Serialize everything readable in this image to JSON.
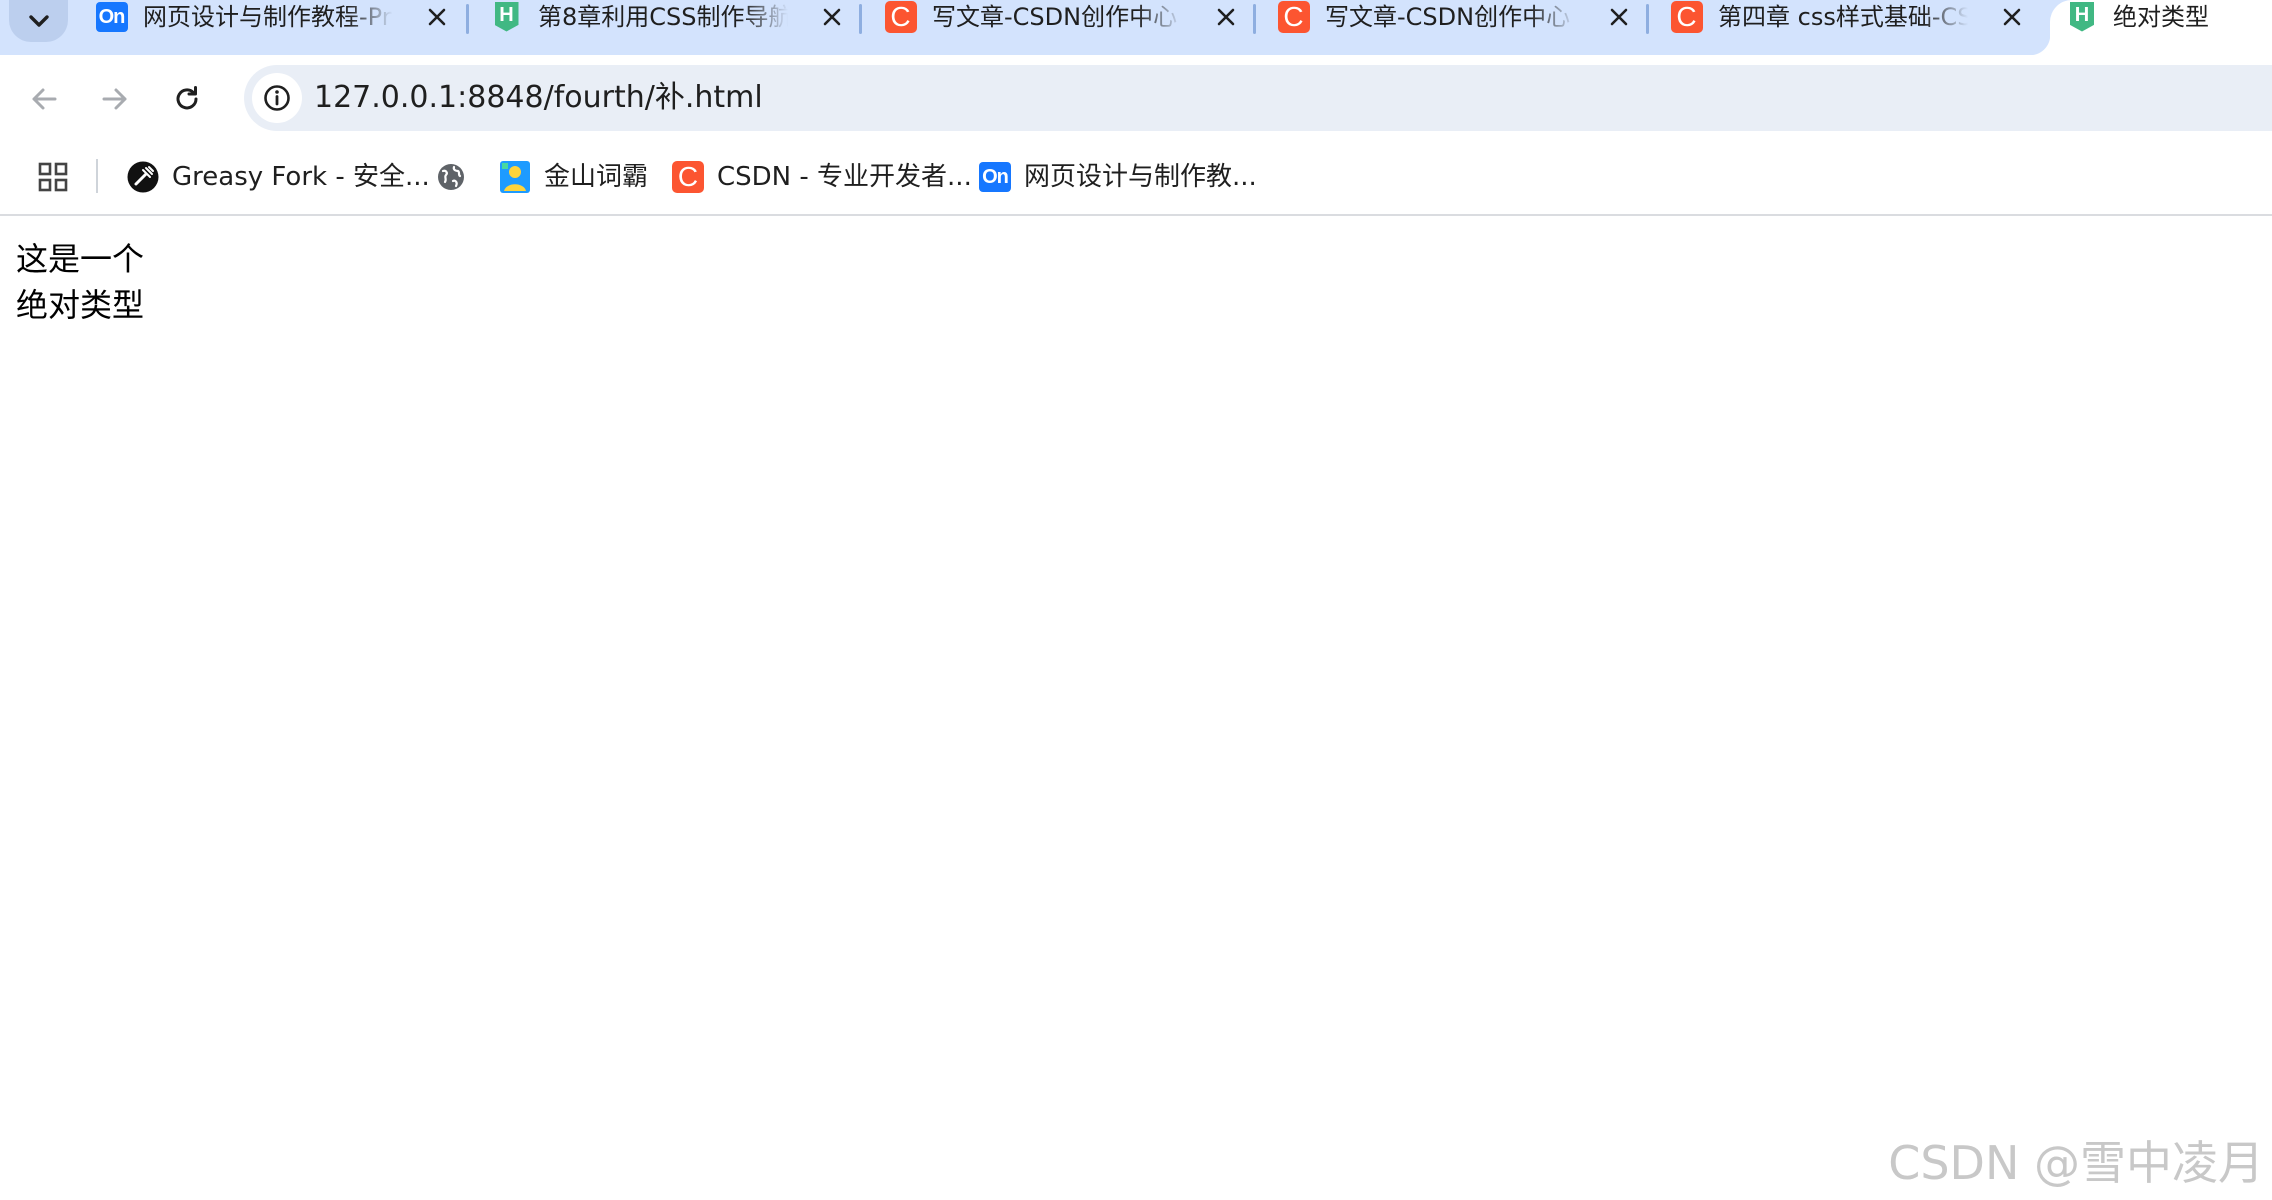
{
  "browser": {
    "tabs": [
      {
        "title": "网页设计与制作教程-Pr",
        "favicon": "On",
        "favicon_type": "baidu-on-icon"
      },
      {
        "title": "第8章利用CSS制作导航",
        "favicon": "H",
        "favicon_type": "hbuilder-icon"
      },
      {
        "title": "写文章-CSDN创作中心",
        "favicon": "C",
        "favicon_type": "csdn-icon"
      },
      {
        "title": "写文章-CSDN创作中心",
        "favicon": "C",
        "favicon_type": "csdn-icon"
      },
      {
        "title": "第四章 css样式基础-CS",
        "favicon": "C",
        "favicon_type": "csdn-icon"
      }
    ],
    "active_tab": {
      "title": "绝对类型",
      "favicon": "H",
      "favicon_type": "hbuilder-icon"
    },
    "address": {
      "url": "127.0.0.1:8848/fourth/补.html"
    },
    "bookmarks": [
      {
        "label": "Greasy Fork - 安全...",
        "icon": "greasyfork-icon"
      },
      {
        "label": "",
        "icon": "globe-icon"
      },
      {
        "label": "金山词霸",
        "icon": "kingsoft-icon"
      },
      {
        "label": "CSDN - 专业开发者...",
        "icon": "csdn-icon",
        "favicon": "C"
      },
      {
        "label": "网页设计与制作教...",
        "icon": "baidu-on-icon",
        "favicon": "On"
      }
    ]
  },
  "page": {
    "lines": [
      "这是一个",
      "绝对类型"
    ],
    "watermark": "CSDN @雪中凌月"
  },
  "colors": {
    "tabstrip_bg": "#d3e3fd",
    "omnibox_bg": "#e9eef6",
    "csdn_red": "#fc5531",
    "hbuilder_green": "#41b883",
    "baidu_blue": "#1677ff"
  }
}
